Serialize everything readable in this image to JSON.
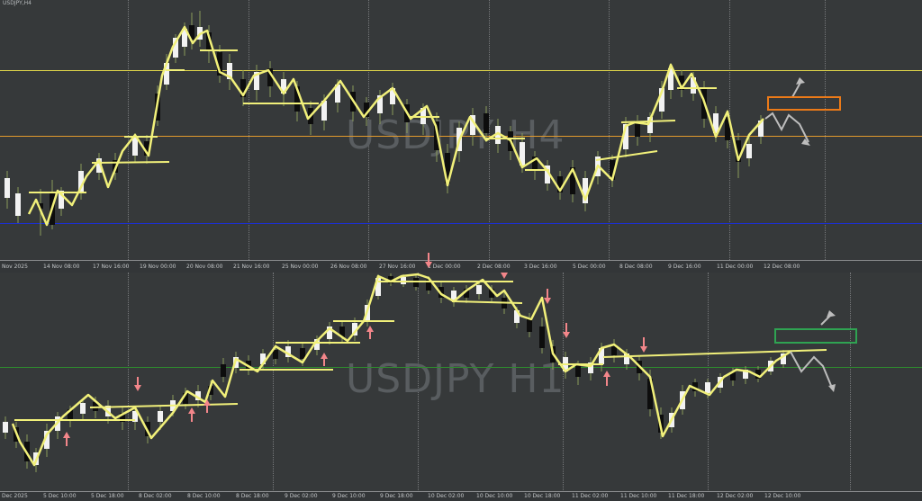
{
  "window": {
    "symbol_label": "USDJPY,H4"
  },
  "panes": {
    "top": {
      "watermark": "USDJPY H4",
      "ticks": [
        "Nov 2025",
        "14 Nov 08:00",
        "17 Nov 16:00",
        "19 Nov 00:00",
        "20 Nov 08:00",
        "21 Nov 16:00",
        "25 Nov 00:00",
        "26 Nov 08:00",
        "27 Nov 16:00",
        "1 Dec 00:00",
        "2 Dec 08:00",
        "3 Dec 16:00",
        "5 Dec 00:00",
        "8 Dec 08:00",
        "9 Dec 16:00",
        "11 Dec 00:00",
        "12 Dec 08:00"
      ]
    },
    "bottom": {
      "watermark": "USDJPY H1",
      "ticks": [
        "Dec 2025",
        "5 Dec 10:00",
        "5 Dec 18:00",
        "8 Dec 02:00",
        "8 Dec 10:00",
        "8 Dec 18:00",
        "9 Dec 02:00",
        "9 Dec 10:00",
        "9 Dec 18:00",
        "10 Dec 02:00",
        "10 Dec 10:00",
        "10 Dec 18:00",
        "11 Dec 02:00",
        "11 Dec 10:00",
        "11 Dec 18:00",
        "12 Dec 02:00",
        "12 Dec 10:00"
      ]
    }
  },
  "colors": {
    "background": "#36393a",
    "resistance_line": "#e3d84a",
    "support_line": "#e39a2c",
    "base_line": "#1c2fd2",
    "level_line_h1": "#2e8a2e",
    "zigzag": "#f1f07a",
    "bull_candle": "#f2f2f2",
    "bear_candle": "#0d0d0d",
    "arrow_up": "#f3868a",
    "forecast_arrow": "#bdbdbd",
    "zone_h4": "#ec7a18",
    "zone_h1": "#2fa352"
  }
}
